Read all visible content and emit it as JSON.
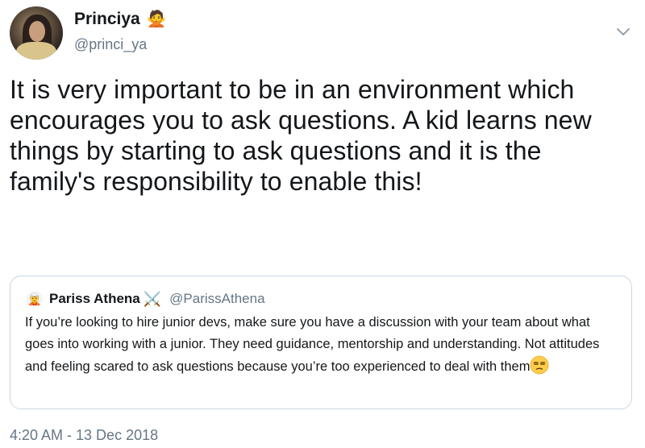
{
  "author": {
    "display_name": "Princiya",
    "handle": "@princi_ya",
    "badge_emoji": "🙅"
  },
  "tweet": {
    "text": "It is very important to be in an environment which encourages you to ask questions. A kid learns new things by starting to ask questions and it is the family's responsibility to enable this!",
    "timestamp": "4:20 AM - 13 Dec 2018"
  },
  "quoted_tweet": {
    "avatar_emoji": "🧝",
    "display_name": "Pariss Athena",
    "name_emoji": "⚔️",
    "handle": "@ParissAthena",
    "text": "If you’re looking to hire junior devs, make sure you have a discussion with your team about what goes into working with a junior. They need guidance, mentorship and understanding. Not attitudes and feeling scared to ask questions because you’re too experienced to deal with them"
  },
  "icons": {
    "menu": "chevron-down-icon",
    "end_emoji": "unamused-face-icon"
  },
  "colors": {
    "text_primary": "#14171a",
    "text_secondary": "#657786",
    "border": "#ccd6dd"
  }
}
